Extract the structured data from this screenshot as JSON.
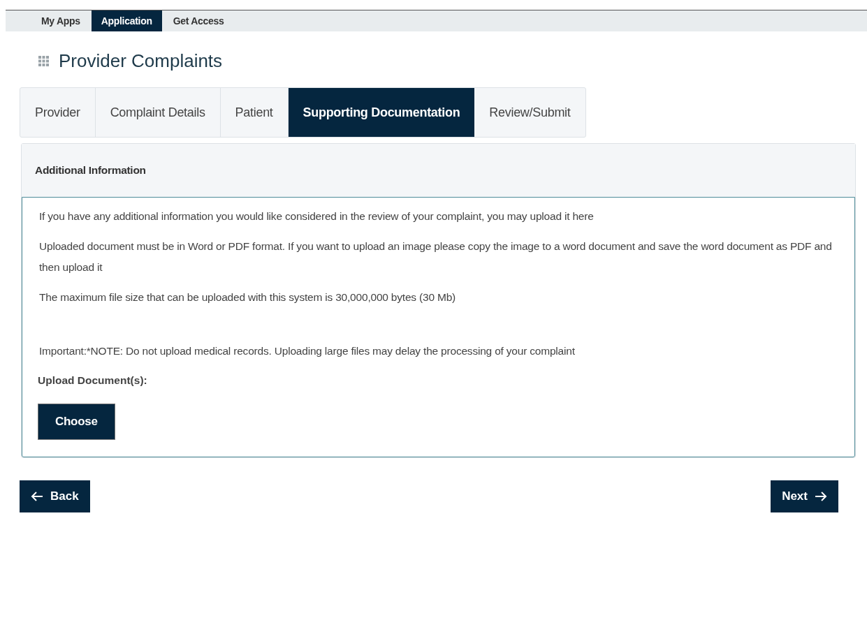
{
  "top_nav": [
    {
      "label": "My Apps",
      "selected": false
    },
    {
      "label": "Application",
      "selected": true
    },
    {
      "label": "Get Access",
      "selected": false
    }
  ],
  "page_title": "Provider Complaints",
  "tabs": [
    {
      "label": "Provider",
      "selected": false
    },
    {
      "label": "Complaint Details",
      "selected": false
    },
    {
      "label": "Patient",
      "selected": false
    },
    {
      "label": "Supporting Documentation",
      "selected": true
    },
    {
      "label": "Review/Submit",
      "selected": false
    }
  ],
  "panel": {
    "title": "Additional Information",
    "paragraphs": [
      "If you have any additional information you would like considered in the review of your complaint, you may upload it here",
      "Uploaded document must be in Word or PDF format. If you want to upload an image please copy the image to a word document and save the word document as PDF and then upload it",
      "The maximum file size that can be uploaded with this system is 30,000,000 bytes (30 Mb)",
      "Important:*NOTE: Do not upload medical records. Uploading large files may delay the processing of your complaint"
    ],
    "upload_label": "Upload Document(s):",
    "choose_button": "Choose"
  },
  "back_button": "Back",
  "next_button": "Next"
}
